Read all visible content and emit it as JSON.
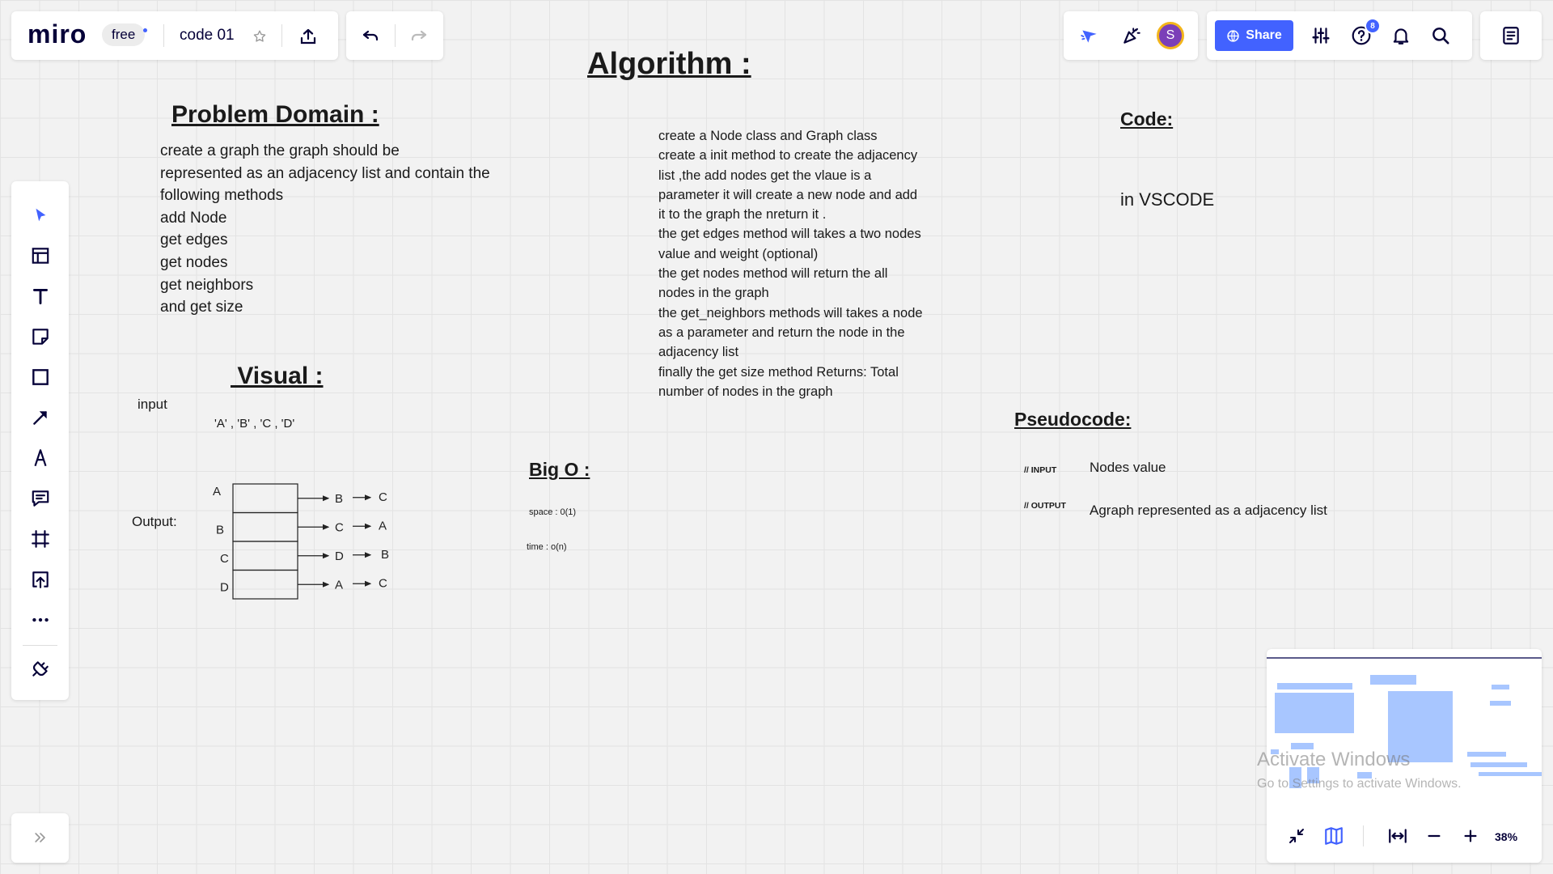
{
  "app": {
    "logo": "miro",
    "plan": "free",
    "board_title": "code 01"
  },
  "header": {
    "share_label": "Share",
    "help_badge": "8",
    "avatar_initial": "S"
  },
  "board": {
    "algorithm_heading": "Algorithm :",
    "problem_heading": "Problem Domain :",
    "problem_lines": [
      "create a graph the graph should  be",
      "represented as an adjacency list and contain the",
      "following methods",
      "add Node",
      "get edges",
      "get nodes",
      "get neighbors",
      "and get size"
    ],
    "algorithm_lines": [
      "create a Node class and Graph class",
      "create a init method to create the adjacency",
      "list ,the add nodes get the vlaue is a",
      "parameter it will create a new node and add",
      "it to the graph the nreturn it .",
      "the get edges method will takes a two nodes",
      "value and weight (optional)",
      " the get nodes method will return the all",
      "nodes in the graph",
      "the get_neighbors methods will takes a node",
      "as a parameter and return the node in the",
      "adjacency list",
      "finally the get size method   Returns: Total",
      "number of nodes in the graph"
    ],
    "code_heading": "Code:",
    "code_text": "in VSCODE",
    "visual_heading": " Visual :",
    "input_label": "input",
    "input_values": "'A' , 'B' , 'C , 'D'",
    "output_label": "Output:",
    "diagram": {
      "rows": [
        {
          "node": "A",
          "first": "B",
          "second": "C"
        },
        {
          "node": "B",
          "first": "C",
          "second": "A"
        },
        {
          "node": "C",
          "first": "D",
          "second": "B"
        },
        {
          "node": "D",
          "first": "A",
          "second": "C"
        }
      ]
    },
    "bigo_heading": "Big O :",
    "space": "space : 0(1)",
    "time": "time : o(n)",
    "pseudo_heading": "Pseudocode:",
    "pseudo_input_tag": "// INPUT",
    "pseudo_input_value": "Nodes value",
    "pseudo_output_tag": "// OUTPUT",
    "pseudo_output_value": "Agraph represented as a adjacency list"
  },
  "zoom": {
    "level": "38%"
  },
  "watermark": {
    "line1": "Activate Windows",
    "line2": "Go to Settings to activate Windows."
  },
  "icons": {
    "toolbar": [
      "select-icon",
      "templates-icon",
      "text-icon",
      "sticky-note-icon",
      "shape-icon",
      "connection-line-icon",
      "pen-icon",
      "comment-icon",
      "frame-icon",
      "upload-icon",
      "more-icon",
      "apps-icon"
    ],
    "header_right": [
      "reactions-icon",
      "celebrate-icon",
      "settings-icon",
      "help-icon",
      "notifications-icon",
      "search-icon",
      "notes-icon"
    ]
  },
  "colors": {
    "accent": "#4262ff",
    "ink": "#050038",
    "minimap_block": "#a8c6ff"
  }
}
